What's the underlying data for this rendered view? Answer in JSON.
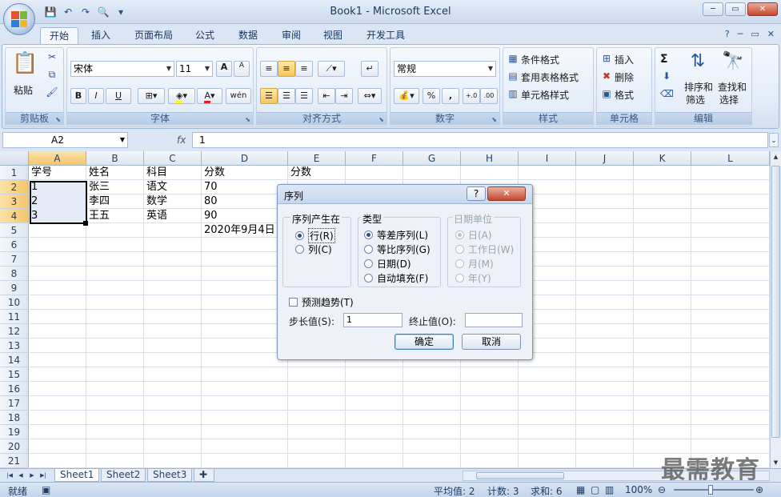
{
  "window": {
    "title": "Book1 - Microsoft Excel",
    "controls": {
      "minimize": "─",
      "restore": "▭",
      "close": "✕"
    },
    "ribbon_controls": {
      "help": "?",
      "minimize": "─",
      "restore": "▭",
      "close": "✕"
    }
  },
  "qat": {
    "save": "💾",
    "undo": "↶",
    "redo": "↷",
    "preview": "🔍",
    "customize": "▾"
  },
  "tabs": [
    "开始",
    "插入",
    "页面布局",
    "公式",
    "数据",
    "审阅",
    "视图",
    "开发工具"
  ],
  "active_tab": "开始",
  "ribbon": {
    "clipboard": {
      "label": "剪贴板",
      "paste": "粘贴"
    },
    "font": {
      "label": "字体",
      "font_name": "宋体",
      "font_size": "11",
      "bold": "B",
      "italic": "I",
      "underline": "U",
      "grow": "A",
      "shrink": "A",
      "wen": "wén",
      "font_color": "A"
    },
    "alignment": {
      "label": "对齐方式"
    },
    "number": {
      "label": "数字",
      "format": "常规",
      "percent": "%",
      "comma": ","
    },
    "styles": {
      "label": "样式",
      "conditional": "条件格式",
      "table": "套用表格格式",
      "cell_styles": "单元格样式"
    },
    "cells": {
      "label": "单元格",
      "insert": "插入",
      "delete": "删除",
      "format": "格式"
    },
    "editing": {
      "label": "编辑",
      "sum": "Σ",
      "sort1": "排序和",
      "sort2": "筛选",
      "find1": "查找和",
      "find2": "选择"
    }
  },
  "formula_bar": {
    "name_box": "A2",
    "fx": "fx",
    "value": "1"
  },
  "columns": [
    "A",
    "B",
    "C",
    "D",
    "E",
    "F",
    "G",
    "H",
    "I",
    "J",
    "K",
    "L"
  ],
  "rows": [
    "1",
    "2",
    "3",
    "4",
    "5",
    "6",
    "7",
    "8",
    "9",
    "10",
    "11",
    "12",
    "13",
    "14",
    "15",
    "16",
    "17",
    "18",
    "19",
    "20",
    "21"
  ],
  "cells": {
    "A1": "学号",
    "B1": "姓名",
    "C1": "科目",
    "D1": "分数",
    "E1": "分数",
    "A2": "1",
    "B2": "张三",
    "C2": "语文",
    "D2": "70",
    "A3": "2",
    "B3": "李四",
    "C3": "数学",
    "D3": "80",
    "A4": "3",
    "B4": "王五",
    "C4": "英语",
    "D4": "90",
    "D5": "2020年9月4日"
  },
  "sheets": [
    "Sheet1",
    "Sheet2",
    "Sheet3"
  ],
  "active_sheet": "Sheet1",
  "status": {
    "ready": "就绪",
    "average": "平均值: 2",
    "count": "计数: 3",
    "sum": "求和: 6",
    "zoom": "100%"
  },
  "dialog": {
    "title": "序列",
    "help": "?",
    "close": "✕",
    "series_in": {
      "label": "序列产生在",
      "rows": "行(R)",
      "cols": "列(C)"
    },
    "type": {
      "label": "类型",
      "linear": "等差序列(L)",
      "growth": "等比序列(G)",
      "date": "日期(D)",
      "autofill": "自动填充(F)"
    },
    "date_unit": {
      "label": "日期单位",
      "day": "日(A)",
      "weekday": "工作日(W)",
      "month": "月(M)",
      "year": "年(Y)"
    },
    "trend": "预测趋势(T)",
    "step_label": "步长值(S):",
    "step_value": "1",
    "stop_label": "终止值(O):",
    "stop_value": "",
    "ok": "确定",
    "cancel": "取消"
  },
  "watermark": "最需教育"
}
